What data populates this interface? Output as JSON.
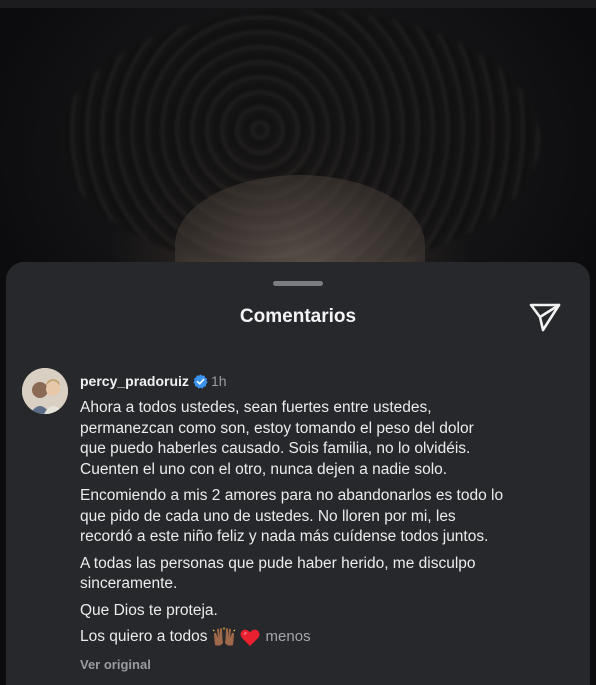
{
  "sheet": {
    "title": "Comentarios",
    "send_icon": "send-paper-plane-icon"
  },
  "comment": {
    "username": "percy_pradoruiz",
    "verified_icon": "verified-badge-icon",
    "time": "1h",
    "paragraphs": [
      [
        "Ahora a todos ustedes, sean fuertes entre ustedes,",
        "permanezcan como son, estoy tomando el peso del dolor",
        "que puedo haberles causado. Sois familia, no lo olvidéis.",
        "Cuenten el uno con el otro, nunca dejen a nadie solo."
      ],
      [
        "Encomiendo a mis 2 amores para no abandonarlos es todo lo",
        "que pido de cada uno de ustedes. No lloren por mi, les",
        "recordó a este niño feliz y nada más cuídense todos juntos."
      ],
      [
        "A todas las personas que pude haber herido, me disculpo",
        "sinceramente."
      ],
      [
        "Que Dios te proteja."
      ]
    ],
    "last_line": "Los quiero a todos",
    "emojis": [
      "raised-hands-emoji",
      "red-heart-emoji"
    ],
    "less_label": "menos",
    "see_original_label": "Ver original"
  },
  "colors": {
    "sheet_bg": "#26282c",
    "text": "#ececec",
    "muted": "#9a9ca1",
    "verified": "#3b93f0",
    "heart": "#e8202f"
  }
}
